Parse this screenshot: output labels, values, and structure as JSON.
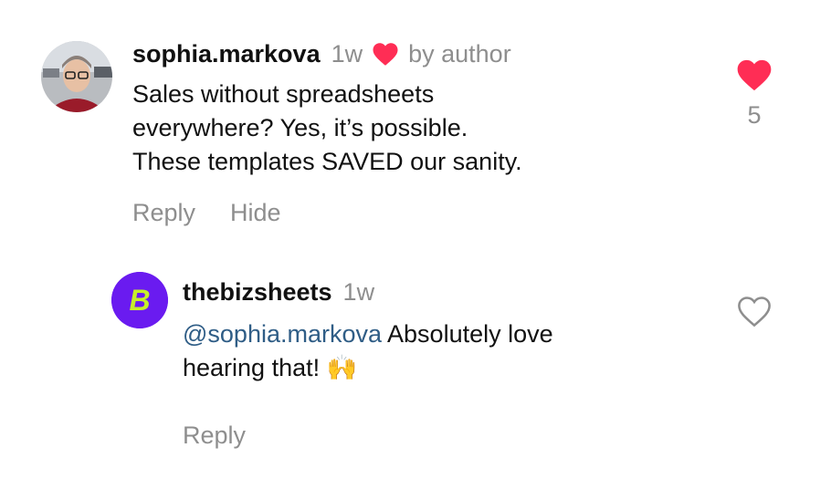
{
  "comment": {
    "username": "sophia.markova",
    "time": "1w",
    "by_author": "by author",
    "body_lines": [
      "Sales without spreadsheets",
      "everywhere? Yes, it’s possible.",
      "These templates SAVED our sanity."
    ],
    "actions": {
      "reply": "Reply",
      "hide": "Hide"
    },
    "like_count": "5",
    "liked": true,
    "heart_icon": "heart-filled-icon"
  },
  "reply": {
    "username": "thebizsheets",
    "time": "1w",
    "mention": "@sophia.markova",
    "text_line1": " Absolutely love",
    "text_line2": "hearing that! ",
    "emoji": "🙌",
    "actions": {
      "reply": "Reply"
    },
    "liked": false,
    "avatar_letter": "B",
    "heart_icon": "heart-outline-icon"
  },
  "colors": {
    "like_red": "#ff2d55",
    "mention_blue": "#2f5d86",
    "brand_purple": "#6a1bf0",
    "brand_lime": "#c6ef2a",
    "muted_gray": "#8e8e8e"
  }
}
